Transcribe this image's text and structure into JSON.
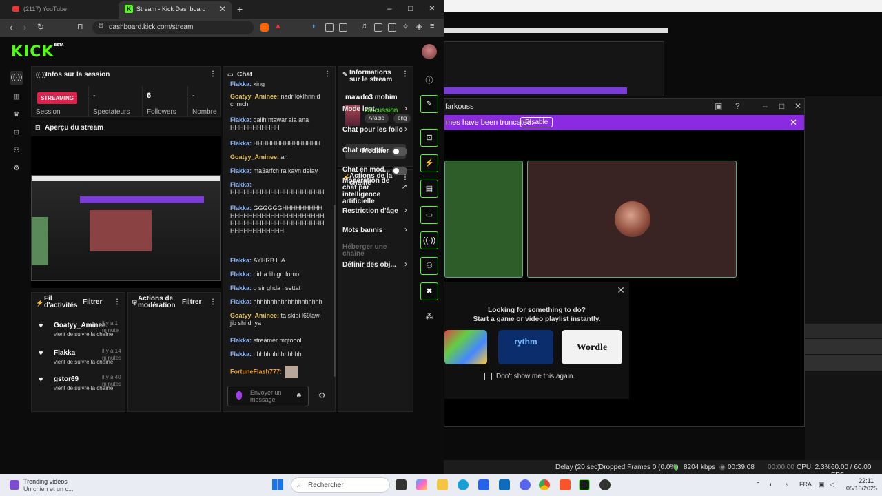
{
  "browser": {
    "tab1_title": "(2117) YouTube",
    "tab2_title": "Stream - Kick Dashboard",
    "url": "dashboard.kick.com/stream"
  },
  "kick": {
    "logo": "KICK",
    "logo_badge": "BETA",
    "session": {
      "title": "Infos sur la session",
      "status": "STREAMING",
      "stats": [
        {
          "value": "",
          "label": "Session"
        },
        {
          "value": "-",
          "label": "Spectateurs"
        },
        {
          "value": "6",
          "label": "Followers"
        },
        {
          "value": "-",
          "label": "Nombre"
        }
      ]
    },
    "preview": {
      "title": "Aperçu du stream"
    },
    "feed": {
      "title": "Fil d'activités",
      "filter": "Filtrer",
      "items": [
        {
          "name": "Goatyy_Aminee",
          "time": "il y a 1 minute",
          "desc": "vient de suivre la chaîne"
        },
        {
          "name": "Flakka",
          "time": "il y a 14 minutes",
          "desc": "vient de suivre la chaîne"
        },
        {
          "name": "gstor69",
          "time": "il y a 40 minutes",
          "desc": "vient de suivre la chaîne"
        }
      ]
    },
    "moderation": {
      "title": "Actions de modération",
      "filter": "Filtrer"
    },
    "chat": {
      "title": "Chat",
      "messages": [
        {
          "user": "Flakka",
          "text": "king",
          "color": "blue"
        },
        {
          "user": "Goatyy_Aminee",
          "text": "nadr lokIhrin d chmch",
          "color": "gold"
        },
        {
          "user": "Flakka",
          "text": "galih ntawar ala ana HHHHHHHHHHH",
          "color": "blue"
        },
        {
          "user": "Flakka",
          "text": "HHHHHHHHHHHHHHH",
          "color": "blue"
        },
        {
          "user": "Goatyy_Aminee",
          "text": "ah",
          "color": "gold"
        },
        {
          "user": "Flakka",
          "text": "ma3arfch ra kayn delay",
          "color": "blue"
        },
        {
          "user": "Flakka",
          "text": "HHHHHHHHHHHHHHHHHHHHH",
          "color": "blue"
        },
        {
          "user": "Flakka",
          "text": "GGGGGGHHHHHHHHHHHHHHHHHHHHHHHHHHHHHHHHHHHHHHHHHHHHHHHHHHHHHHHHHHHHHHH",
          "color": "blue"
        },
        {
          "user": "Flakka",
          "text": "AYHRB LIA",
          "color": "blue"
        },
        {
          "user": "Flakka",
          "text": "dirha lih gd fomo",
          "color": "blue"
        },
        {
          "user": "Flakka",
          "text": "o sir ghda l settat",
          "color": "blue"
        },
        {
          "user": "Flakka",
          "text": "hhhhhhhhhhhhhhhhhhhh",
          "color": "blue"
        },
        {
          "user": "Goatyy_Aminee",
          "text": "ta skipi l69lawi jib shi driya",
          "color": "gold"
        },
        {
          "user": "Flakka",
          "text": "streamer mqtoool",
          "color": "blue"
        },
        {
          "user": "Flakka",
          "text": "hhhhhhhhhhhhhh",
          "color": "blue"
        },
        {
          "user": "FortuneFlash777",
          "text": "",
          "color": "orange"
        }
      ],
      "input_placeholder": "Envoyer un message"
    },
    "stream_info": {
      "title": "Informations sur le stream",
      "stream_title": "mawdo3 mohim",
      "category": "Discussion",
      "tags": [
        "Arabic",
        "eng"
      ],
      "edit_button": "Modifier"
    },
    "channel_actions": {
      "title": "Actions de la chaîne",
      "options": [
        {
          "label": "Mode lent",
          "kind": "chevron"
        },
        {
          "label": "Chat pour les follo",
          "kind": "chevron"
        },
        {
          "label": "Chat réservé...",
          "kind": "toggle"
        },
        {
          "label": "Chat en mod...",
          "kind": "toggle"
        },
        {
          "label": "Modération de chat par intelligence artificielle",
          "kind": "external"
        },
        {
          "label": "Restriction d'âge",
          "kind": "chevron"
        },
        {
          "label": "Mots bannis",
          "kind": "chevron"
        },
        {
          "label": "Héberger une chaîne",
          "kind": "disabled"
        },
        {
          "label": "Définir des obj...",
          "kind": "chevron"
        }
      ]
    }
  },
  "discord": {
    "title": "farkouss",
    "banner": "mes have been truncated.",
    "banner_button": "Disable",
    "activity_line1": "Looking for something to do?",
    "activity_line2": "Start a game or video playlist instantly.",
    "games": [
      "rythm",
      "Wordle"
    ],
    "dont_show": "Don't show me this again."
  },
  "obs_status": {
    "delay": "Delay (20 sec)",
    "dropped": "Dropped Frames 0 (0.0%)",
    "bitrate": "8204 kbps",
    "rec_time": "00:39:08",
    "stream_time": "00:00:00",
    "cpu": "CPU: 2.3%",
    "fps": "60.00 / 60.00 FPS"
  },
  "taskbar": {
    "news_title": "Trending videos",
    "news_sub": "Un chien et un c...",
    "search": "Rechercher",
    "lang": "FRA",
    "time": "22:11",
    "date": "05/10/2025"
  }
}
